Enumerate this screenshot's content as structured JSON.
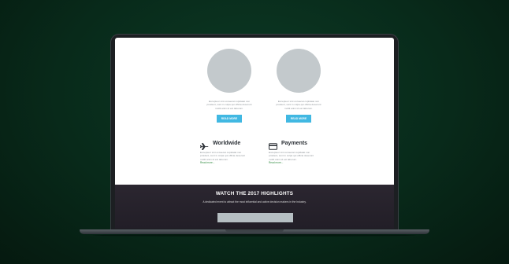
{
  "columns": [
    {
      "text": "Excepteur sint occaecat cupidatat non proident, sunt in culpa qui officia deserunt mollit anim id est laborum.",
      "button": "READ MORE"
    },
    {
      "text": "Excepteur sint occaecat cupidatat non proident, sunt in culpa qui officia deserunt mollit anim id est laborum.",
      "button": "READ MORE"
    }
  ],
  "features": [
    {
      "icon": "airplane-icon",
      "title": "Worldwide",
      "text": "Excepteur sint occaecat cupidatat non proident, sunt in culpa qui officia deserunt mollit anim id est laborum.",
      "link": "Read more..."
    },
    {
      "icon": "credit-card-icon",
      "title": "Payments",
      "text": "Excepteur sint occaecat cupidatat non proident, sunt in culpa qui officia deserunt mollit anim id est laborum.",
      "link": "Read more..."
    }
  ],
  "highlights": {
    "title": "WATCH THE 2017 HIGHLIGHTS",
    "subtitle": "A dedicated event to attract the most influential and active decision makers in the Industry."
  },
  "colors": {
    "background": "#0a2e1d",
    "button_blue": "#41b8e2",
    "link_green": "#2f8a3f",
    "band_dark": "#2b2630"
  }
}
